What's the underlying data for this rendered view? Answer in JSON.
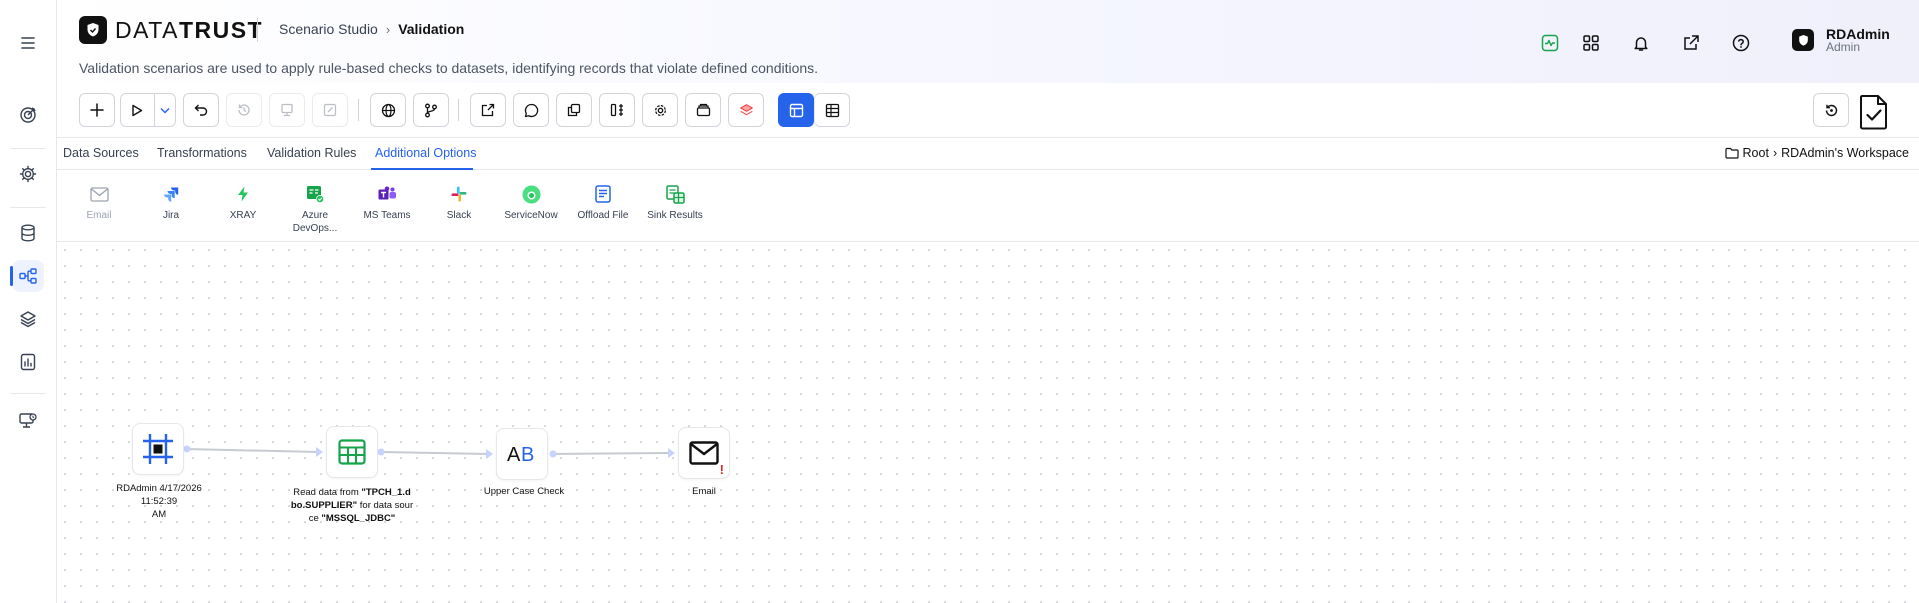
{
  "header": {
    "logo": {
      "light": "DATA",
      "bold": "TRUST"
    },
    "breadcrumb": {
      "parent": "Scenario Studio",
      "current": "Validation"
    },
    "description": "Validation scenarios are used to apply rule-based checks to datasets, identifying records that violate defined conditions.",
    "icons": [
      "activity-icon",
      "apps-grid-icon",
      "bell-icon",
      "external-link-icon",
      "help-icon"
    ],
    "user": {
      "name": "RDAdmin",
      "role": "Admin"
    }
  },
  "rail": {
    "items": [
      "menu-icon",
      "target-icon",
      "gear-icon",
      "database-icon",
      "workflow-icon",
      "layers-icon",
      "report-icon",
      "monitor-icon"
    ],
    "active": "workflow-icon"
  },
  "toolbar": {
    "buttons": [
      "add",
      "run",
      "run-options",
      "undo",
      "history",
      "deploy",
      "edit",
      "globe",
      "branch",
      "export",
      "comment",
      "copy",
      "compare",
      "settings",
      "archive",
      "layers",
      "layout-view",
      "table-view"
    ],
    "active": "layout-view"
  },
  "tabs": {
    "items": [
      "Data Sources",
      "Transformations",
      "Validation Rules",
      "Additional Options"
    ],
    "active": "Additional Options",
    "workspace": {
      "root": "Root",
      "name": "RDAdmin's Workspace"
    }
  },
  "palette": [
    {
      "label": "Email",
      "icon": "email-icon",
      "disabled": true
    },
    {
      "label": "Jira",
      "icon": "jira-icon"
    },
    {
      "label": "XRAY",
      "icon": "xray-icon"
    },
    {
      "label": "Azure",
      "label2": "DevOps...",
      "icon": "azure-devops-icon"
    },
    {
      "label": "MS Teams",
      "icon": "ms-teams-icon"
    },
    {
      "label": "Slack",
      "icon": "slack-icon"
    },
    {
      "label": "ServiceNow",
      "icon": "servicenow-icon"
    },
    {
      "label": "Offload File",
      "icon": "offload-file-icon"
    },
    {
      "label": "Sink Results",
      "icon": "sink-results-icon"
    }
  ],
  "flow": {
    "nodes": [
      {
        "id": "start",
        "icon": "scenario-start-icon",
        "label": "RDAdmin 4/17/2026 11:52:39",
        "label2": "AM"
      },
      {
        "id": "source",
        "icon": "table-icon",
        "label_pre": "Read data from ",
        "label_bold1": "\"TPCH_1.d",
        "label_bold2": "bo.SUPPLIER\"",
        "label_mid": " for data sour",
        "label_end_pre": "ce ",
        "label_bold3": "\"MSSQL_JDBC\""
      },
      {
        "id": "rule",
        "icon": "uppercase-ab-icon",
        "label": "Upper Case Check"
      },
      {
        "id": "email",
        "icon": "envelope-icon",
        "label": "Email",
        "warning": "!"
      }
    ]
  },
  "colors": {
    "accent": "#2563eb",
    "warning": "#dc2626",
    "green": "#16a34a"
  }
}
